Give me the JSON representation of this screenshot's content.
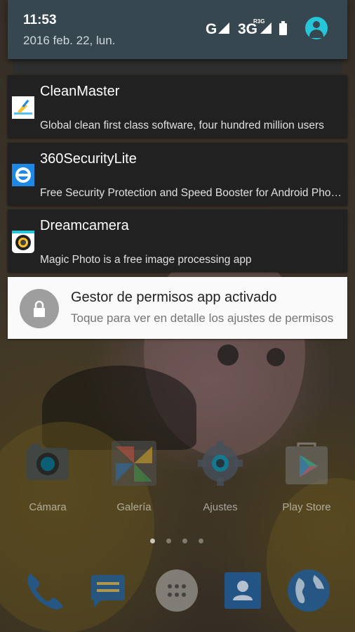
{
  "status_bar": {
    "time": "11:53",
    "date": "2016 feb. 22, lun.",
    "network_g": "G",
    "network_3g": "3G",
    "network_r3g": "R3G",
    "icons": [
      "signal-icon",
      "signal-icon",
      "battery-icon",
      "user-icon"
    ]
  },
  "notifications": [
    {
      "app": "CleanMaster",
      "title": "CleanMaster",
      "text": "Global clean first class software, four hundred million users",
      "icon": "broom-icon"
    },
    {
      "app": "360SecurityLite",
      "title": "360SecurityLite",
      "text": "Free Security Protection and Speed Booster for Android Phones",
      "icon": "shield-icon"
    },
    {
      "app": "Dreamcamera",
      "title": "Dreamcamera",
      "text": "Magic Photo is a free image processing app",
      "icon": "camera-lens-icon"
    }
  ],
  "permission_notification": {
    "title": "Gestor de permisos app activado",
    "text": "Toque para ver en detalle los ajustes de permisos",
    "icon": "lock-icon"
  },
  "home_apps": [
    {
      "label": "Cámara",
      "icon": "camera-icon"
    },
    {
      "label": "Galería",
      "icon": "gallery-icon"
    },
    {
      "label": "Ajustes",
      "icon": "settings-icon"
    },
    {
      "label": "Play Store",
      "icon": "play-store-icon"
    }
  ],
  "page_indicator": {
    "pages": 4,
    "current": 1
  },
  "dock": [
    "phone-icon",
    "messages-icon",
    "app-drawer-icon",
    "contacts-icon",
    "browser-icon"
  ],
  "colors": {
    "header_bg": "#37474f",
    "card_dark": "#212121",
    "card_light": "#fafafa",
    "accent": "#26c6da"
  }
}
